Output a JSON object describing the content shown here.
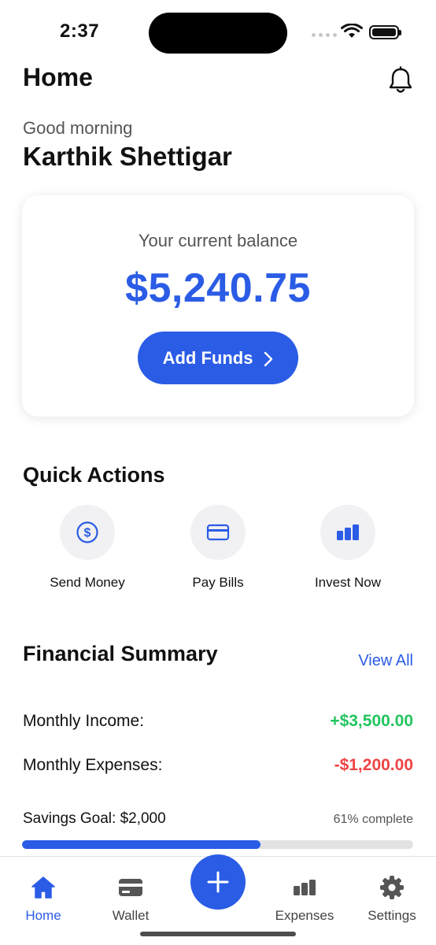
{
  "status_bar": {
    "time": "2:37"
  },
  "header": {
    "title": "Home",
    "icon": "bell-icon"
  },
  "greeting": {
    "salutation": "Good morning",
    "name": "Karthik Shettigar"
  },
  "balance_card": {
    "label": "Your current balance",
    "amount": "$5,240.75",
    "button_label": "Add Funds"
  },
  "quick_actions": {
    "title": "Quick Actions",
    "items": [
      {
        "label": "Send Money",
        "icon": "dollar-circle-icon"
      },
      {
        "label": "Pay Bills",
        "icon": "credit-card-icon"
      },
      {
        "label": "Invest Now",
        "icon": "bar-chart-icon"
      }
    ]
  },
  "financial_summary": {
    "title": "Financial Summary",
    "view_all": "View All",
    "income_label": "Monthly Income:",
    "income_value": "+$3,500.00",
    "expense_label": "Monthly Expenses:",
    "expense_value": "-$1,200.00",
    "savings_label": "Savings Goal: $2,000",
    "savings_complete": "61% complete",
    "savings_progress": 0.61
  },
  "tab_bar": {
    "items": [
      {
        "label": "Home",
        "icon": "home-icon",
        "active": true
      },
      {
        "label": "Wallet",
        "icon": "wallet-icon"
      },
      {
        "label": "Expenses",
        "icon": "bar-chart-icon"
      },
      {
        "label": "Settings",
        "icon": "gear-icon"
      }
    ],
    "fab_icon": "plus-icon"
  },
  "colors": {
    "accent": "#2b5ce6",
    "income": "#22c55e",
    "expense": "#ef4444"
  }
}
